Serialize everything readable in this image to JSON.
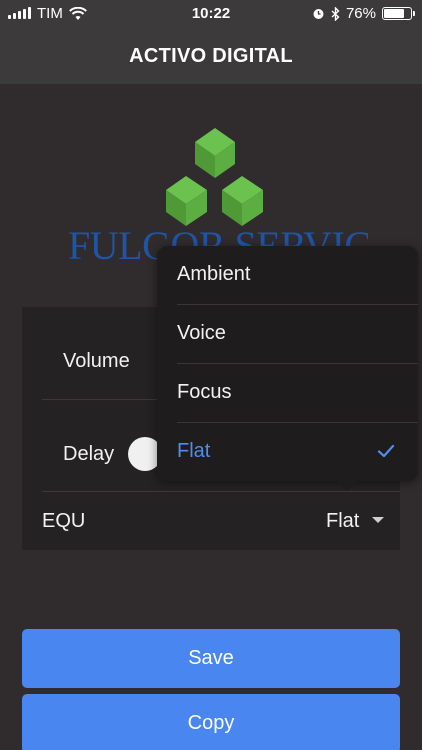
{
  "status_bar": {
    "carrier": "TIM",
    "time": "10:22",
    "battery": "76%",
    "battery_level": 0.76,
    "icons": [
      "signal-icon",
      "wifi-icon",
      "alarm-icon",
      "bluetooth-icon",
      "battery-icon"
    ]
  },
  "header": {
    "title": "ACTIVO DIGITAL"
  },
  "logo": {
    "text": "FULGOR SERVICE",
    "cube_color": "#5cae43",
    "text_color": "#1f55a8"
  },
  "settings": {
    "volume_label": "Volume",
    "delay_label": "Delay",
    "equ_label": "EQU",
    "equ_value": "Flat"
  },
  "dropdown": {
    "options": [
      {
        "label": "Ambient",
        "selected": false
      },
      {
        "label": "Voice",
        "selected": false
      },
      {
        "label": "Focus",
        "selected": false
      },
      {
        "label": "Flat",
        "selected": true
      }
    ],
    "selected_color": "#4f8ef0"
  },
  "buttons": {
    "save_label": "Save",
    "copy_label": "Copy",
    "color": "#4a86ef"
  }
}
